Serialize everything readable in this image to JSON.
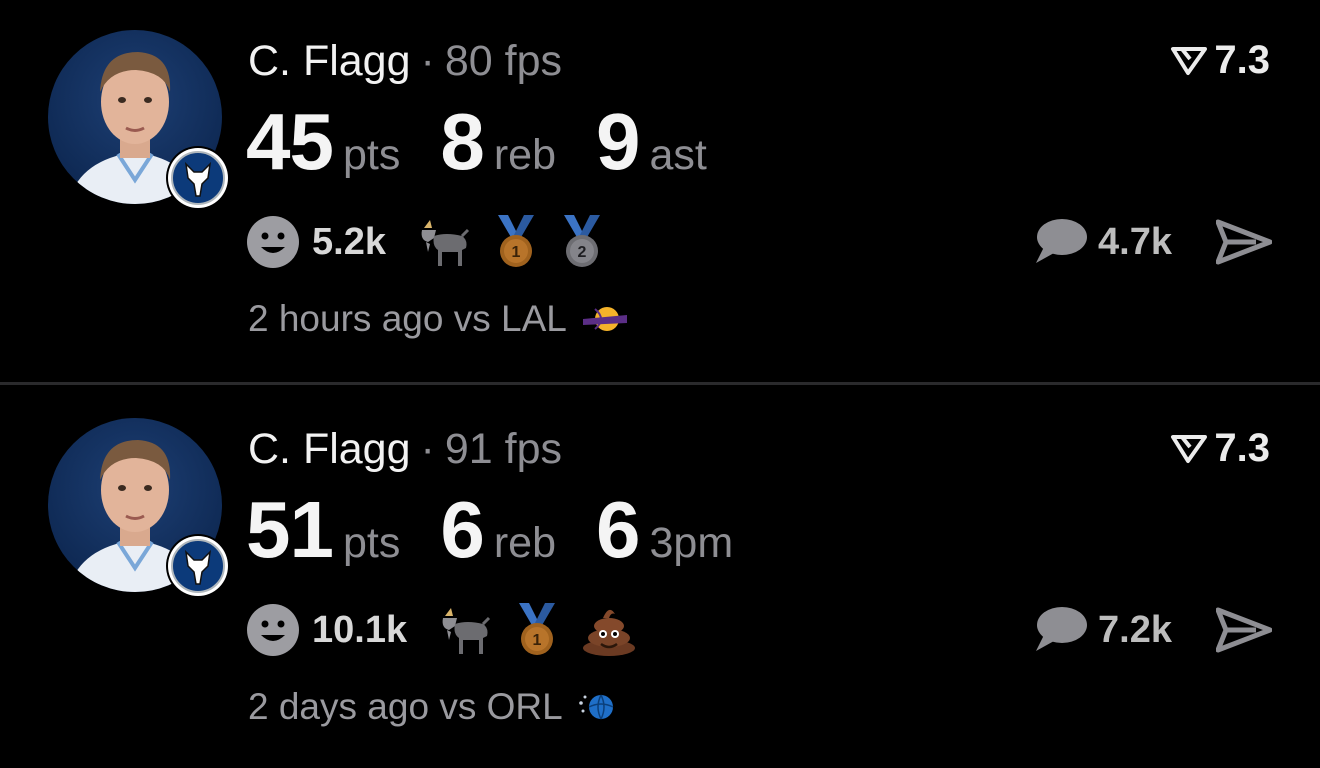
{
  "feed": [
    {
      "player_name": "C. Flagg",
      "separator": "·",
      "fps": "80 fps",
      "rating": "7.3",
      "stats": [
        {
          "value": "45",
          "label": "pts"
        },
        {
          "value": "8",
          "label": "reb"
        },
        {
          "value": "9",
          "label": "ast"
        }
      ],
      "reactions_count": "5.2k",
      "emojis": [
        "goat-icon",
        "gold-medal-icon",
        "silver-medal-icon"
      ],
      "comments_count": "4.7k",
      "time_ago": "2 hours ago",
      "versus": "vs LAL",
      "opponent_logo": "lakers-logo",
      "team_badge": "mavericks-logo"
    },
    {
      "player_name": "C. Flagg",
      "separator": "·",
      "fps": "91 fps",
      "rating": "7.3",
      "stats": [
        {
          "value": "51",
          "label": "pts"
        },
        {
          "value": "6",
          "label": "reb"
        },
        {
          "value": "6",
          "label": "3pm"
        }
      ],
      "reactions_count": "10.1k",
      "emojis": [
        "goat-icon",
        "gold-medal-icon",
        "poop-icon"
      ],
      "comments_count": "7.2k",
      "time_ago": "2 days ago",
      "versus": "vs ORL",
      "opponent_logo": "magic-logo",
      "team_badge": "mavericks-logo"
    }
  ],
  "colors": {
    "background": "#000000",
    "primary_text": "#f4f4f4",
    "secondary_text": "#8e8e93",
    "divider": "#2a2a2c"
  }
}
